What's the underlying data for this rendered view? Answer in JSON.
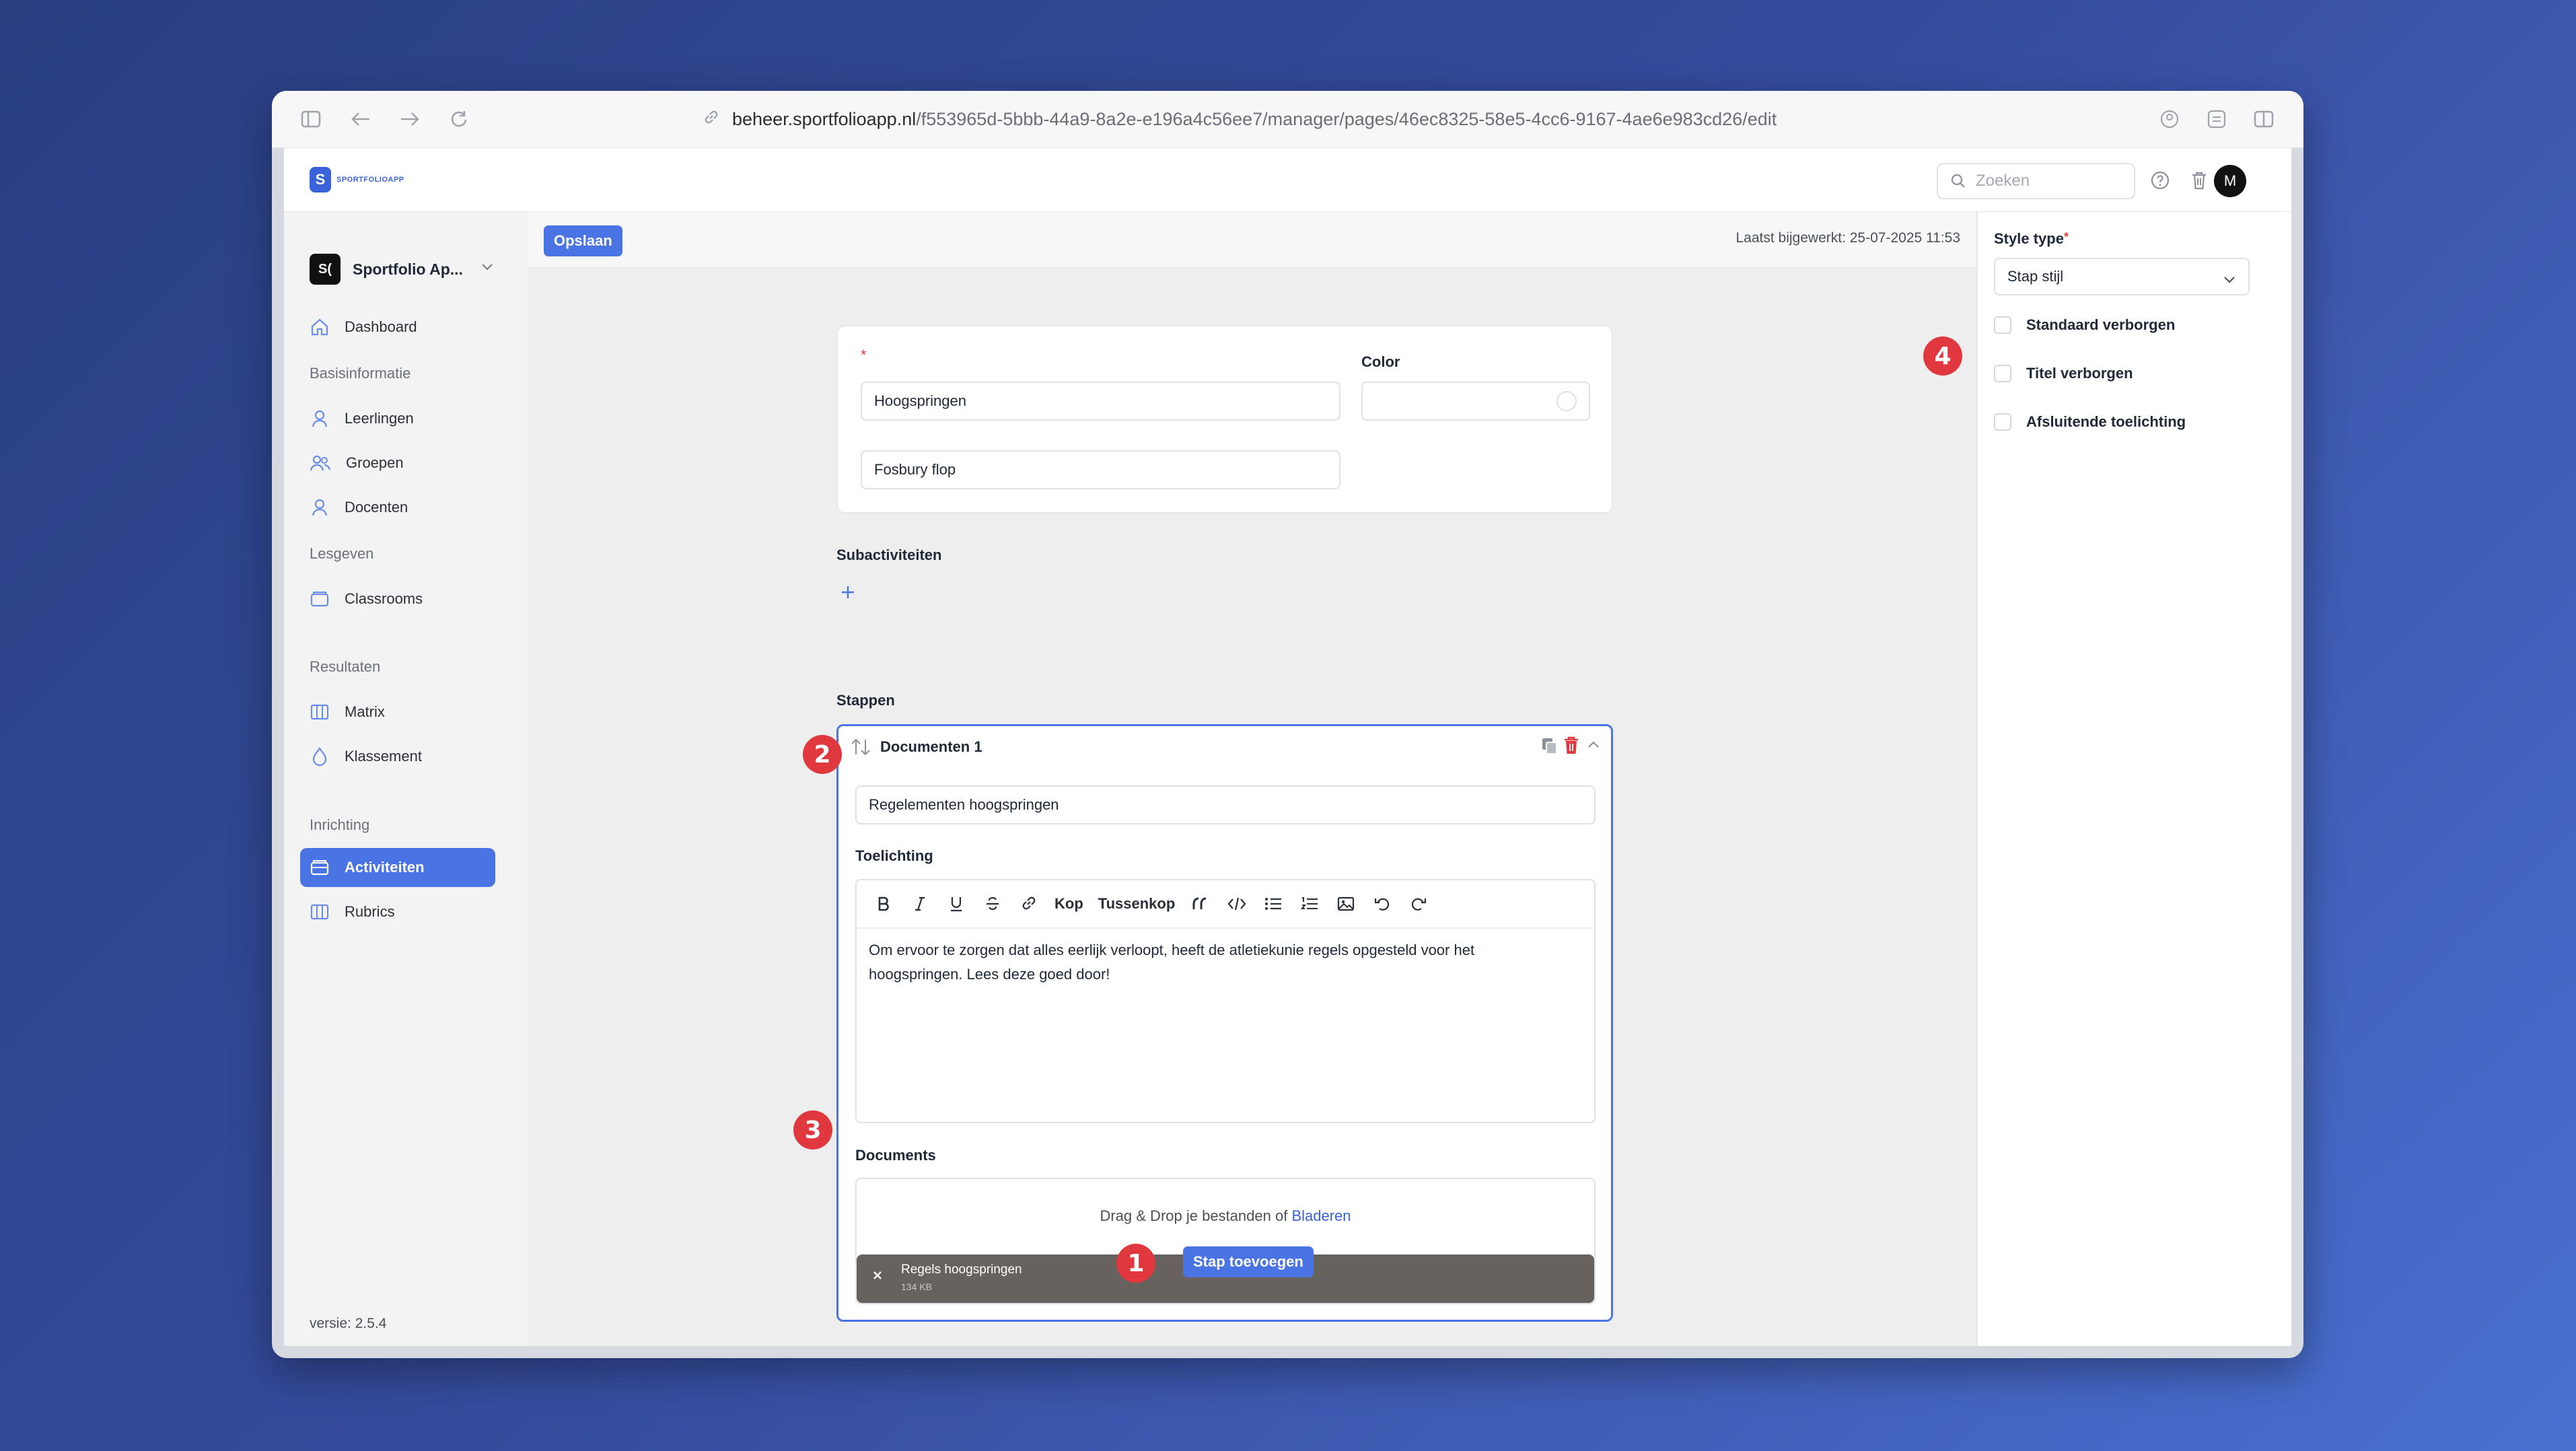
{
  "browser": {
    "url_domain": "beheer.sportfolioapp.nl",
    "url_path": "/f553965d-5bbb-44a9-8a2e-e196a4c56ee7/manager/pages/46ec8325-58e5-4cc6-9167-4ae6e983cd26/edit"
  },
  "topbar": {
    "logo_text": "SPORTFOLIOAPP",
    "search_placeholder": "Zoeken",
    "avatar_initial": "M"
  },
  "sidebar": {
    "org_badge": "S(",
    "org_name": "Sportfolio Ap...",
    "dashboard": "Dashboard",
    "section_basis": "Basisinformatie",
    "leerlingen": "Leerlingen",
    "groepen": "Groepen",
    "docenten": "Docenten",
    "section_lesgeven": "Lesgeven",
    "classrooms": "Classrooms",
    "section_resultaten": "Resultaten",
    "matrix": "Matrix",
    "klassement": "Klassement",
    "section_inrichting": "Inrichting",
    "activiteiten": "Activiteiten",
    "rubrics": "Rubrics",
    "version": "versie: 2.5.4"
  },
  "main": {
    "save_label": "Opslaan",
    "last_updated": "Laatst bijgewerkt: 25-07-2025 11:53",
    "required_mark": "*",
    "color_label": "Color",
    "title_value": "Hoogspringen",
    "subtitle_value": "Fosbury flop",
    "subactivities_label": "Subactiviteiten",
    "steps_label": "Stappen",
    "step": {
      "title": "Documenten 1",
      "name_value": "Regelementen hoogspringen",
      "explanation_label": "Toelichting",
      "toolbar_heading": "Kop",
      "toolbar_subheading": "Tussenkop",
      "editor_line1": "Om ervoor te zorgen dat alles eerlijk verloopt, heeft de atletiekunie regels opgesteld voor het",
      "editor_line2": "hoogspringen. Lees deze goed door!",
      "documents_label": "Documents",
      "drop_text": "Drag & Drop je bestanden of",
      "browse_link": "Bladeren",
      "file_name": "Regels hoogspringen",
      "file_size": "134 KB"
    },
    "add_step_label": "Stap toevoegen"
  },
  "right_panel": {
    "style_type_label": "Style type",
    "style_type_value": "Stap stijl",
    "check_standard_hidden": "Standaard verborgen",
    "check_title_hidden": "Titel verborgen",
    "check_closing_note": "Afsluitende toelichting"
  },
  "markers": [
    "1",
    "2",
    "3",
    "4"
  ],
  "colors": {
    "accent": "#4a74e4",
    "marker": "#e0383e",
    "file_pill": "#67625e"
  }
}
